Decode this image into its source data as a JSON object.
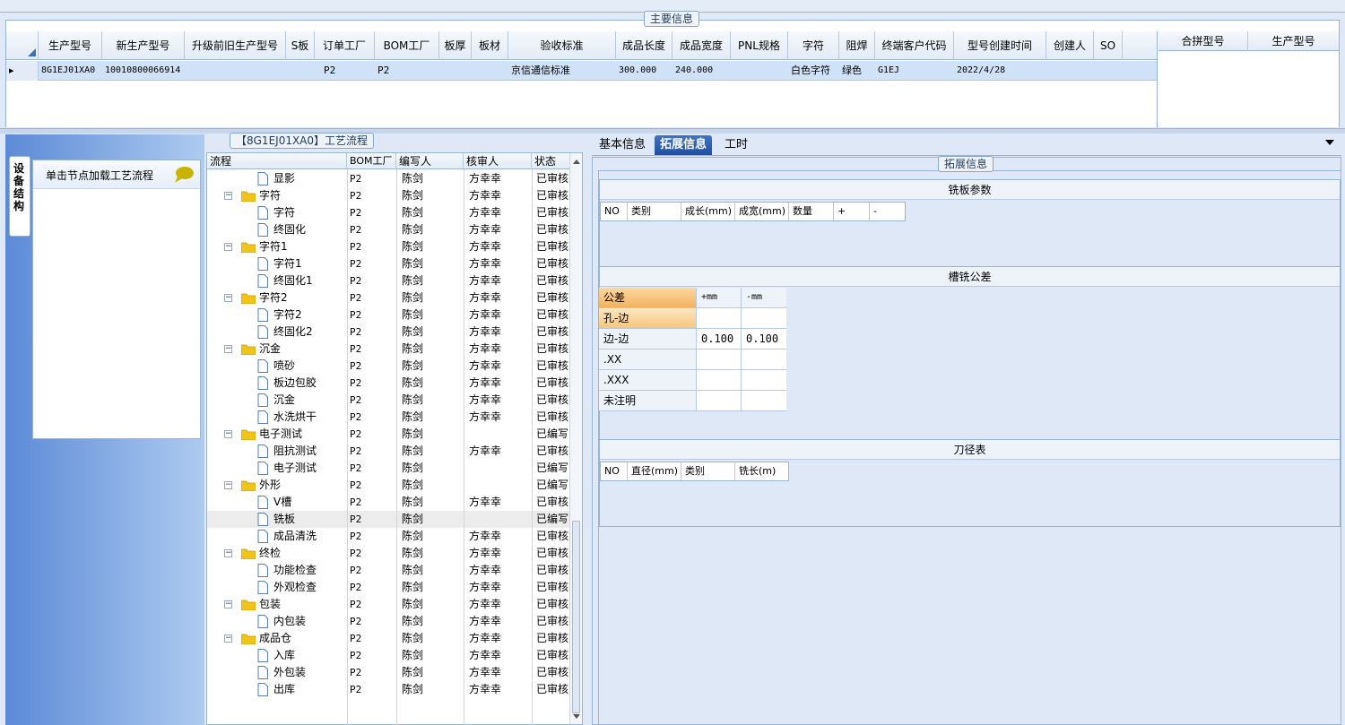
{
  "main_info": {
    "title": "主要信息",
    "columns": [
      "生产型号",
      "新生产型号",
      "升级前旧生产型号",
      "S板",
      "订单工厂",
      "BOM工厂",
      "板厚",
      "板材",
      "验收标准",
      "成品长度",
      "成品宽度",
      "PNL规格",
      "字符",
      "阻焊",
      "终端客户代码",
      "型号创建时间",
      "创建人",
      "SO"
    ],
    "row": {
      "prod_model": "8G1EJ01XA0",
      "new_prod_model": "10010800066914",
      "old_model": "",
      "s_board": "",
      "order_factory": "P2",
      "bom_factory": "P2",
      "thickness": "",
      "material": "",
      "standard": "京信通信标准",
      "length": "300.000",
      "width": "240.000",
      "pnl": "",
      "char": "白色字符",
      "solder": "绿色",
      "customer": "G1EJ",
      "created": "2022/4/28",
      "creator": "",
      "so": ""
    },
    "merge_columns": [
      "合拼型号",
      "生产型号"
    ]
  },
  "left": {
    "vtab_label": "设备结构",
    "hint": "单击节点加载工艺流程"
  },
  "process": {
    "title": "【8G1EJ01XA0】工艺流程",
    "headers": [
      "流程",
      "BOM工厂",
      "编写人",
      "核审人",
      "状态"
    ],
    "rows": [
      {
        "name": "显影",
        "level": 2,
        "bom": "P2",
        "writer": "陈剑",
        "reviewer": "方幸幸",
        "status": "已审核"
      },
      {
        "name": "字符",
        "level": 1,
        "bom": "P2",
        "writer": "陈剑",
        "reviewer": "方幸幸",
        "status": "已审核"
      },
      {
        "name": "字符",
        "level": 2,
        "bom": "P2",
        "writer": "陈剑",
        "reviewer": "方幸幸",
        "status": "已审核"
      },
      {
        "name": "终固化",
        "level": 2,
        "bom": "P2",
        "writer": "陈剑",
        "reviewer": "方幸幸",
        "status": "已审核"
      },
      {
        "name": "字符1",
        "level": 1,
        "bom": "P2",
        "writer": "陈剑",
        "reviewer": "方幸幸",
        "status": "已审核"
      },
      {
        "name": "字符1",
        "level": 2,
        "bom": "P2",
        "writer": "陈剑",
        "reviewer": "方幸幸",
        "status": "已审核"
      },
      {
        "name": "终固化1",
        "level": 2,
        "bom": "P2",
        "writer": "陈剑",
        "reviewer": "方幸幸",
        "status": "已审核"
      },
      {
        "name": "字符2",
        "level": 1,
        "bom": "P2",
        "writer": "陈剑",
        "reviewer": "方幸幸",
        "status": "已审核"
      },
      {
        "name": "字符2",
        "level": 2,
        "bom": "P2",
        "writer": "陈剑",
        "reviewer": "方幸幸",
        "status": "已审核"
      },
      {
        "name": "终固化2",
        "level": 2,
        "bom": "P2",
        "writer": "陈剑",
        "reviewer": "方幸幸",
        "status": "已审核"
      },
      {
        "name": "沉金",
        "level": 1,
        "bom": "P2",
        "writer": "陈剑",
        "reviewer": "方幸幸",
        "status": "已审核"
      },
      {
        "name": "喷砂",
        "level": 2,
        "bom": "P2",
        "writer": "陈剑",
        "reviewer": "方幸幸",
        "status": "已审核"
      },
      {
        "name": "板边包胶",
        "level": 2,
        "bom": "P2",
        "writer": "陈剑",
        "reviewer": "方幸幸",
        "status": "已审核"
      },
      {
        "name": "沉金",
        "level": 2,
        "bom": "P2",
        "writer": "陈剑",
        "reviewer": "方幸幸",
        "status": "已审核"
      },
      {
        "name": "水洗烘干",
        "level": 2,
        "bom": "P2",
        "writer": "陈剑",
        "reviewer": "方幸幸",
        "status": "已审核"
      },
      {
        "name": "电子测试",
        "level": 1,
        "bom": "P2",
        "writer": "陈剑",
        "reviewer": "",
        "status": "已编写"
      },
      {
        "name": "阻抗测试",
        "level": 2,
        "bom": "P2",
        "writer": "陈剑",
        "reviewer": "方幸幸",
        "status": "已审核"
      },
      {
        "name": "电子测试",
        "level": 2,
        "bom": "P2",
        "writer": "陈剑",
        "reviewer": "",
        "status": "已编写"
      },
      {
        "name": "外形",
        "level": 1,
        "bom": "P2",
        "writer": "陈剑",
        "reviewer": "",
        "status": "已编写"
      },
      {
        "name": "V槽",
        "level": 2,
        "bom": "P2",
        "writer": "陈剑",
        "reviewer": "方幸幸",
        "status": "已审核"
      },
      {
        "name": "铣板",
        "level": 2,
        "bom": "P2",
        "writer": "陈剑",
        "reviewer": "",
        "status": "已编写",
        "selected": true
      },
      {
        "name": "成品清洗",
        "level": 2,
        "bom": "P2",
        "writer": "陈剑",
        "reviewer": "方幸幸",
        "status": "已审核"
      },
      {
        "name": "终检",
        "level": 1,
        "bom": "P2",
        "writer": "陈剑",
        "reviewer": "方幸幸",
        "status": "已审核"
      },
      {
        "name": "功能检查",
        "level": 2,
        "bom": "P2",
        "writer": "陈剑",
        "reviewer": "方幸幸",
        "status": "已审核"
      },
      {
        "name": "外观检查",
        "level": 2,
        "bom": "P2",
        "writer": "陈剑",
        "reviewer": "方幸幸",
        "status": "已审核"
      },
      {
        "name": "包装",
        "level": 1,
        "bom": "P2",
        "writer": "陈剑",
        "reviewer": "方幸幸",
        "status": "已审核"
      },
      {
        "name": "内包装",
        "level": 2,
        "bom": "P2",
        "writer": "陈剑",
        "reviewer": "方幸幸",
        "status": "已审核"
      },
      {
        "name": "成品仓",
        "level": 1,
        "bom": "P2",
        "writer": "陈剑",
        "reviewer": "方幸幸",
        "status": "已审核"
      },
      {
        "name": "入库",
        "level": 2,
        "bom": "P2",
        "writer": "陈剑",
        "reviewer": "方幸幸",
        "status": "已审核"
      },
      {
        "name": "外包装",
        "level": 2,
        "bom": "P2",
        "writer": "陈剑",
        "reviewer": "方幸幸",
        "status": "已审核"
      },
      {
        "name": "出库",
        "level": 2,
        "bom": "P2",
        "writer": "陈剑",
        "reviewer": "方幸幸",
        "status": "已审核"
      }
    ]
  },
  "right": {
    "tabs": [
      "基本信息",
      "拓展信息",
      "工时"
    ],
    "active_tab": "拓展信息",
    "ext_title": "拓展信息",
    "mill_params": {
      "title": "铣板参数",
      "headers": [
        "NO",
        "类别",
        "成长(mm)",
        "成宽(mm)",
        "数量",
        "+",
        "-"
      ]
    },
    "slot_tolerance": {
      "title": "槽铣公差",
      "headers": [
        "公差",
        "+mm",
        "-mm"
      ],
      "rows": [
        {
          "label": "孔-边",
          "plus": "",
          "minus": ""
        },
        {
          "label": "边-边",
          "plus": "0.100",
          "minus": "0.100"
        },
        {
          "label": ".XX",
          "plus": "",
          "minus": ""
        },
        {
          "label": ".XXX",
          "plus": "",
          "minus": ""
        },
        {
          "label": "未注明",
          "plus": "",
          "minus": ""
        }
      ]
    },
    "tool_table": {
      "title": "刀径表",
      "headers": [
        "NO",
        "直径(mm)",
        "类别",
        "铣长(m)"
      ]
    }
  }
}
